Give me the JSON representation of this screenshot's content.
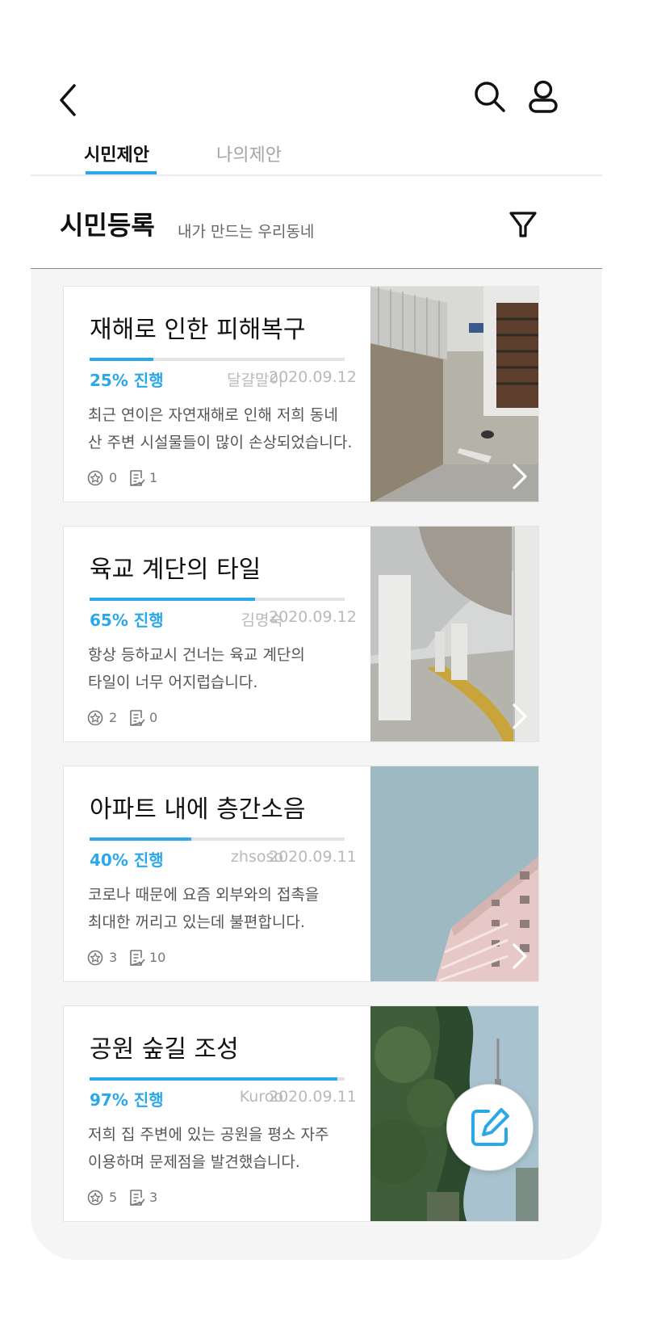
{
  "header": {
    "back_icon": "chevron-left-icon",
    "search_icon": "search-icon",
    "user_icon": "user-icon"
  },
  "tabs": [
    {
      "label": "시민제안",
      "active": true
    },
    {
      "label": "나의제안",
      "active": false
    }
  ],
  "section": {
    "title": "시민등록",
    "subtitle": "내가 만드는 우리동네",
    "filter_icon": "filter-icon"
  },
  "colors": {
    "accent": "#2aa8ea",
    "muted_text": "#b9b9b9",
    "list_background": "#f5f5f5"
  },
  "proposals": [
    {
      "title": "재해로 인한 피해복구",
      "progress": 0.25,
      "progress_label": "25% 진행",
      "author": "달걀말이",
      "date": "2020.09.12",
      "description": [
        "최근 연이은 자연재해로 인해 저희 동네",
        "산 주변 시설물들이 많이 손상되었습니다."
      ],
      "likes": "0",
      "comments": "1",
      "photo": "alley-with-fence-photo"
    },
    {
      "title": "육교 계단의 타일",
      "progress": 0.65,
      "progress_label": "65% 진행",
      "author": "김명숙",
      "date": "2020.09.12",
      "description": [
        "항상 등하교시  건너는 육교 계단의",
        "타일이 너무 어지럽습니다."
      ],
      "likes": "2",
      "comments": "0",
      "photo": "underpass-pillars-photo"
    },
    {
      "title": "아파트 내에 층간소음",
      "progress": 0.4,
      "progress_label": "40% 진행",
      "author": "zhsoso",
      "date": "2020.09.11",
      "description": [
        "코로나 때문에 요즘 외부와의 접촉을",
        "최대한 꺼리고 있는데 불편합니다."
      ],
      "likes": "3",
      "comments": "10",
      "photo": "apartment-building-photo"
    },
    {
      "title": "공원 숲길 조성",
      "progress": 0.97,
      "progress_label": "97% 진행",
      "author": "Kuroo",
      "date": "2020.09.11",
      "description": [
        "저희 집 주변에 있는 공원을 평소 자주",
        "이용하며 문제점을 발견했습니다."
      ],
      "likes": "5",
      "comments": "3",
      "photo": "park-trees-photo"
    }
  ],
  "fab": {
    "icon": "edit-icon"
  }
}
